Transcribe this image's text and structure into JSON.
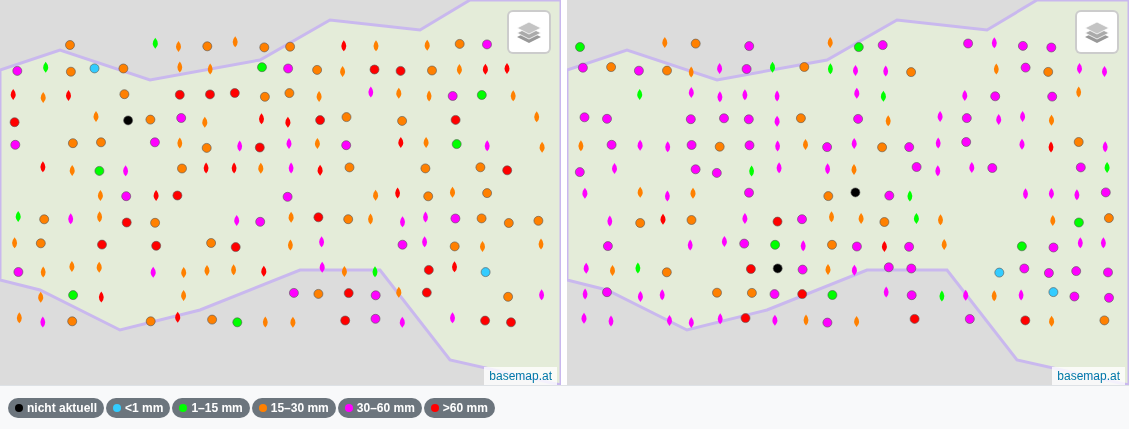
{
  "maps": [
    {
      "attribution": "basemap.at"
    },
    {
      "attribution": "basemap.at"
    }
  ],
  "legend": [
    {
      "label": "nicht aktuell",
      "color": "#000000"
    },
    {
      "label": "<1 mm",
      "color": "#33ccff"
    },
    {
      "label": "1–15 mm",
      "color": "#00ff00"
    },
    {
      "label": "15–30 mm",
      "color": "#ff8000"
    },
    {
      "label": "30–60 mm",
      "color": "#ff00ff"
    },
    {
      "label": ">60 mm",
      "color": "#ff0000"
    }
  ]
}
